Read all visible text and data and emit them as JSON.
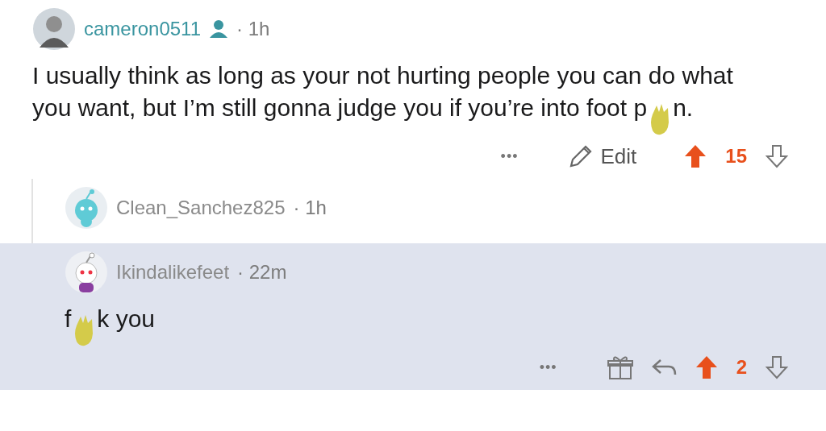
{
  "comment": {
    "author": "cameron0511",
    "op_badge": true,
    "age": "· 1h",
    "highlighted": false,
    "body": [
      {
        "kind": "text",
        "text": "I usually think as long as your not hurting people you can do what you want, but I’m still gonna judge you if you’re into foot p"
      },
      {
        "kind": "censor"
      },
      {
        "kind": "text",
        "text": "n."
      }
    ],
    "actions": {
      "more": "•••",
      "edit": "Edit",
      "gift": false,
      "reply": false,
      "score": "15",
      "upvoted": true
    },
    "children": [
      {
        "author": "Clean_Sanchez825",
        "op_badge": false,
        "age": "· 1h",
        "highlighted": false
      },
      {
        "author": "Ikindalikefeet",
        "op_badge": false,
        "age": "· 22m",
        "highlighted": true,
        "body": [
          {
            "kind": "text",
            "text": "f"
          },
          {
            "kind": "censor"
          },
          {
            "kind": "text",
            "text": "k you"
          }
        ],
        "actions": {
          "more": "•••",
          "gift": true,
          "reply": true,
          "score": "2",
          "upvoted": true
        }
      }
    ]
  }
}
